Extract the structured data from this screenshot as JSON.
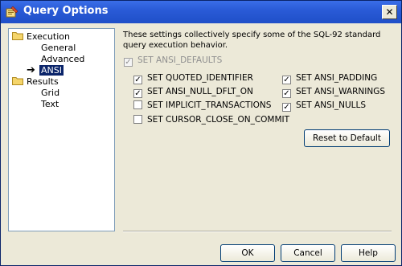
{
  "window": {
    "title": "Query Options",
    "close_glyph": "✕"
  },
  "tree": {
    "execution": {
      "label": "Execution",
      "children": [
        "General",
        "Advanced",
        "ANSI"
      ]
    },
    "results": {
      "label": "Results",
      "children": [
        "Grid",
        "Text"
      ]
    },
    "selected": "ANSI",
    "selected_marker": "➔"
  },
  "description": "These settings collectively specify some of the SQL-92 standard query execution behavior.",
  "options": {
    "ansi_defaults": {
      "label": "SET ANSI_DEFAULTS",
      "checked": true,
      "enabled": false
    },
    "left": [
      {
        "label": "SET QUOTED_IDENTIFIER",
        "checked": true
      },
      {
        "label": "SET ANSI_NULL_DFLT_ON",
        "checked": true
      },
      {
        "label": "SET IMPLICIT_TRANSACTIONS",
        "checked": false
      },
      {
        "label": "SET CURSOR_CLOSE_ON_COMMIT",
        "checked": false
      }
    ],
    "right": [
      {
        "label": "SET ANSI_PADDING",
        "checked": true
      },
      {
        "label": "SET ANSI_WARNINGS",
        "checked": true
      },
      {
        "label": "SET ANSI_NULLS",
        "checked": true
      }
    ]
  },
  "buttons": {
    "reset": "Reset to Default",
    "ok": "OK",
    "cancel": "Cancel",
    "help": "Help"
  },
  "colors": {
    "title_bar": "#2a5bd7",
    "dialog_bg": "#ece9d8",
    "selection": "#0a246a"
  }
}
